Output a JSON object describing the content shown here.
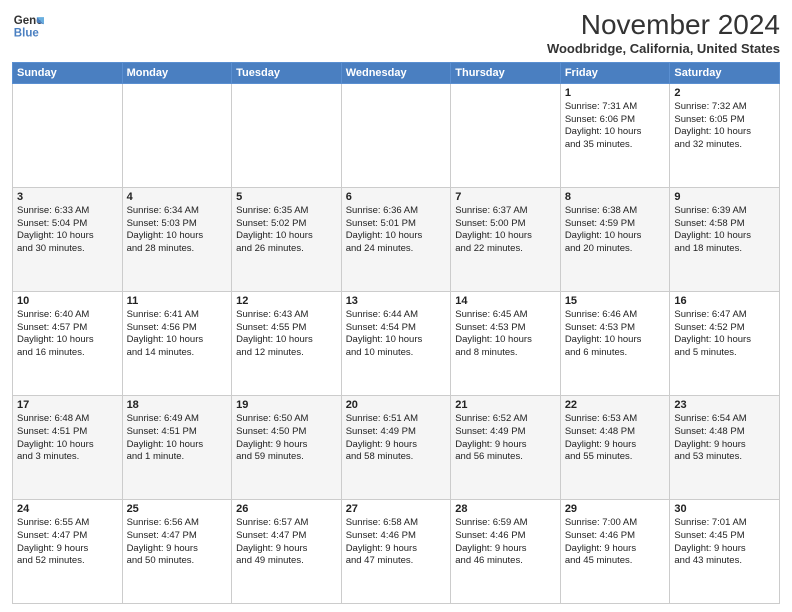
{
  "header": {
    "logo_line1": "General",
    "logo_line2": "Blue",
    "month": "November 2024",
    "location": "Woodbridge, California, United States"
  },
  "days_of_week": [
    "Sunday",
    "Monday",
    "Tuesday",
    "Wednesday",
    "Thursday",
    "Friday",
    "Saturday"
  ],
  "weeks": [
    [
      {
        "day": "",
        "info": ""
      },
      {
        "day": "",
        "info": ""
      },
      {
        "day": "",
        "info": ""
      },
      {
        "day": "",
        "info": ""
      },
      {
        "day": "",
        "info": ""
      },
      {
        "day": "1",
        "info": "Sunrise: 7:31 AM\nSunset: 6:06 PM\nDaylight: 10 hours\nand 35 minutes."
      },
      {
        "day": "2",
        "info": "Sunrise: 7:32 AM\nSunset: 6:05 PM\nDaylight: 10 hours\nand 32 minutes."
      }
    ],
    [
      {
        "day": "3",
        "info": "Sunrise: 6:33 AM\nSunset: 5:04 PM\nDaylight: 10 hours\nand 30 minutes."
      },
      {
        "day": "4",
        "info": "Sunrise: 6:34 AM\nSunset: 5:03 PM\nDaylight: 10 hours\nand 28 minutes."
      },
      {
        "day": "5",
        "info": "Sunrise: 6:35 AM\nSunset: 5:02 PM\nDaylight: 10 hours\nand 26 minutes."
      },
      {
        "day": "6",
        "info": "Sunrise: 6:36 AM\nSunset: 5:01 PM\nDaylight: 10 hours\nand 24 minutes."
      },
      {
        "day": "7",
        "info": "Sunrise: 6:37 AM\nSunset: 5:00 PM\nDaylight: 10 hours\nand 22 minutes."
      },
      {
        "day": "8",
        "info": "Sunrise: 6:38 AM\nSunset: 4:59 PM\nDaylight: 10 hours\nand 20 minutes."
      },
      {
        "day": "9",
        "info": "Sunrise: 6:39 AM\nSunset: 4:58 PM\nDaylight: 10 hours\nand 18 minutes."
      }
    ],
    [
      {
        "day": "10",
        "info": "Sunrise: 6:40 AM\nSunset: 4:57 PM\nDaylight: 10 hours\nand 16 minutes."
      },
      {
        "day": "11",
        "info": "Sunrise: 6:41 AM\nSunset: 4:56 PM\nDaylight: 10 hours\nand 14 minutes."
      },
      {
        "day": "12",
        "info": "Sunrise: 6:43 AM\nSunset: 4:55 PM\nDaylight: 10 hours\nand 12 minutes."
      },
      {
        "day": "13",
        "info": "Sunrise: 6:44 AM\nSunset: 4:54 PM\nDaylight: 10 hours\nand 10 minutes."
      },
      {
        "day": "14",
        "info": "Sunrise: 6:45 AM\nSunset: 4:53 PM\nDaylight: 10 hours\nand 8 minutes."
      },
      {
        "day": "15",
        "info": "Sunrise: 6:46 AM\nSunset: 4:53 PM\nDaylight: 10 hours\nand 6 minutes."
      },
      {
        "day": "16",
        "info": "Sunrise: 6:47 AM\nSunset: 4:52 PM\nDaylight: 10 hours\nand 5 minutes."
      }
    ],
    [
      {
        "day": "17",
        "info": "Sunrise: 6:48 AM\nSunset: 4:51 PM\nDaylight: 10 hours\nand 3 minutes."
      },
      {
        "day": "18",
        "info": "Sunrise: 6:49 AM\nSunset: 4:51 PM\nDaylight: 10 hours\nand 1 minute."
      },
      {
        "day": "19",
        "info": "Sunrise: 6:50 AM\nSunset: 4:50 PM\nDaylight: 9 hours\nand 59 minutes."
      },
      {
        "day": "20",
        "info": "Sunrise: 6:51 AM\nSunset: 4:49 PM\nDaylight: 9 hours\nand 58 minutes."
      },
      {
        "day": "21",
        "info": "Sunrise: 6:52 AM\nSunset: 4:49 PM\nDaylight: 9 hours\nand 56 minutes."
      },
      {
        "day": "22",
        "info": "Sunrise: 6:53 AM\nSunset: 4:48 PM\nDaylight: 9 hours\nand 55 minutes."
      },
      {
        "day": "23",
        "info": "Sunrise: 6:54 AM\nSunset: 4:48 PM\nDaylight: 9 hours\nand 53 minutes."
      }
    ],
    [
      {
        "day": "24",
        "info": "Sunrise: 6:55 AM\nSunset: 4:47 PM\nDaylight: 9 hours\nand 52 minutes."
      },
      {
        "day": "25",
        "info": "Sunrise: 6:56 AM\nSunset: 4:47 PM\nDaylight: 9 hours\nand 50 minutes."
      },
      {
        "day": "26",
        "info": "Sunrise: 6:57 AM\nSunset: 4:47 PM\nDaylight: 9 hours\nand 49 minutes."
      },
      {
        "day": "27",
        "info": "Sunrise: 6:58 AM\nSunset: 4:46 PM\nDaylight: 9 hours\nand 47 minutes."
      },
      {
        "day": "28",
        "info": "Sunrise: 6:59 AM\nSunset: 4:46 PM\nDaylight: 9 hours\nand 46 minutes."
      },
      {
        "day": "29",
        "info": "Sunrise: 7:00 AM\nSunset: 4:46 PM\nDaylight: 9 hours\nand 45 minutes."
      },
      {
        "day": "30",
        "info": "Sunrise: 7:01 AM\nSunset: 4:45 PM\nDaylight: 9 hours\nand 43 minutes."
      }
    ]
  ]
}
